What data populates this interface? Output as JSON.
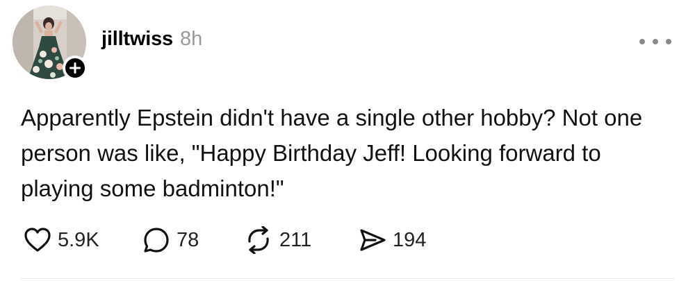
{
  "post": {
    "username": "jilltwiss",
    "time": "8h",
    "text": "Apparently Epstein didn't have a single other hobby? Not one person was like, \"Happy Birthday Jeff! Looking forward to playing some badminton!\"",
    "follow_symbol": "+",
    "more_icon": "ellipsis-icon"
  },
  "actions": {
    "like": {
      "icon": "heart-icon",
      "count": "5.9K"
    },
    "reply": {
      "icon": "comment-icon",
      "count": "78"
    },
    "repost": {
      "icon": "repost-icon",
      "count": "211"
    },
    "share": {
      "icon": "send-icon",
      "count": "194"
    }
  },
  "colors": {
    "text": "#000000",
    "muted": "#9a9a9a",
    "badge": "#000000",
    "divider": "#e6e6e6"
  }
}
